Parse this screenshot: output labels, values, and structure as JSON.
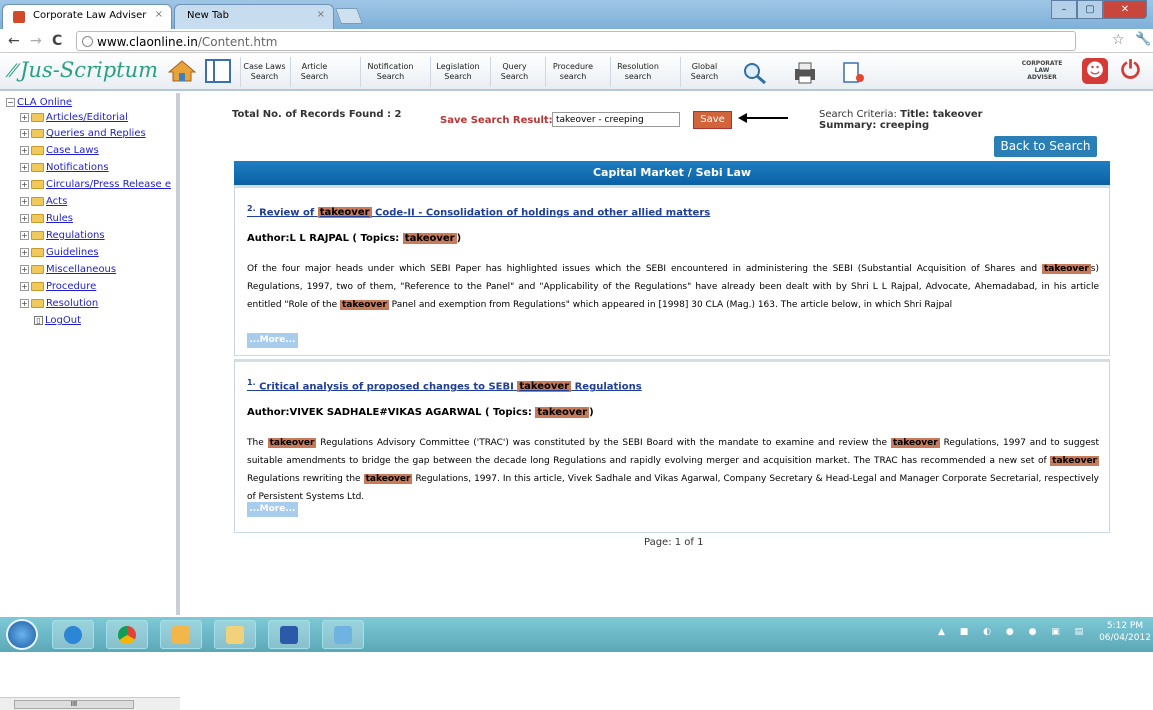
{
  "browser": {
    "tabs": [
      {
        "title": "Corporate Law Adviser",
        "active": true
      },
      {
        "title": "New Tab",
        "active": false
      }
    ],
    "url_domain": "www.claonline.in",
    "url_path": "/Content.htm"
  },
  "app": {
    "logo_text": "Jus-Scriptum",
    "toolbar": [
      {
        "line1": "Case Laws",
        "line2": "Search"
      },
      {
        "line1": "Article",
        "line2": "Search"
      },
      {
        "line1": "Notification",
        "line2": "Search"
      },
      {
        "line1": "Legislation",
        "line2": "Search"
      },
      {
        "line1": "Query",
        "line2": "Search"
      },
      {
        "line1": "Procedure",
        "line2": "search"
      },
      {
        "line1": "Resolution",
        "line2": "search"
      },
      {
        "line1": "Global",
        "line2": "Search"
      }
    ],
    "cla_logo": [
      "CORPORATE",
      "LAW",
      "ADVISER"
    ]
  },
  "sidebar": {
    "root": "CLA Online",
    "items": [
      "Articles/Editorial",
      "Queries and Replies",
      "Case Laws",
      "Notifications",
      "Circulars/Press Release e",
      "Acts",
      "Rules",
      "Regulations",
      "Guidelines",
      "Miscellaneous",
      "Procedure",
      "Resolution"
    ],
    "logout": "LogOut",
    "scroll_thumb": "III"
  },
  "results": {
    "total_label": "Total No. of Records Found : 2",
    "save_label": "Save Search Result:",
    "save_value": "takeover - creeping",
    "save_button": "Save",
    "criteria_label": "Search Criteria:",
    "criteria_title": "Title: takeover",
    "criteria_summary": "Summary: creeping",
    "back_button": "Back to Search",
    "category_header": "Capital Market / Sebi Law",
    "highlight_term": "takeover",
    "items": [
      {
        "number": "2.",
        "title_pre": "Review of",
        "title_post": "Code-II - Consolidation of holdings and other allied matters",
        "author_pre": "Author:L L RAJPAL ( Topics:",
        "author_post": ")",
        "body": [
          "Of the four major heads under which SEBI Paper has highlighted issues which the SEBI encountered in administering the SEBI (Substantial Acquisition of Shares and ",
          "s) Regulations, 1997, two of them, \"Reference to the Panel\" and \"Applicability of the Regulations\" have already been dealt with by Shri L L Rajpal, Advocate, Ahemadabad, in his article entitled \"Role of the ",
          " Panel and exemption from Regulations\" which appeared in [1998] 30 CLA (Mag.) 163. The article below, in which Shri Rajpal"
        ],
        "more": "...More..."
      },
      {
        "number": "1.",
        "title_pre": "Critical analysis of proposed changes to SEBI",
        "title_post": "Regulations",
        "author_pre": "Author:VIVEK SADHALE#VIKAS AGARWAL ( Topics:",
        "author_post": ")",
        "body": [
          "The ",
          " Regulations Advisory Committee ('TRAC') was constituted by the SEBI Board with the mandate to examine and review the ",
          " Regulations, 1997 and to suggest suitable amendments to bridge the gap between the decade long Regulations and rapidly evolving merger and acquisition market. The TRAC has recommended a new set of ",
          " Regulations rewriting the ",
          " Regulations, 1997. In this article, Vivek Sadhale and Vikas Agarwal, Company Secretary & Head-Legal and Manager Corporate Secretarial, respectively of Persistent Systems Ltd."
        ],
        "more": "...More..."
      }
    ],
    "page_info": "Page: 1 of 1"
  },
  "taskbar": {
    "time": "5:12 PM",
    "date": "06/04/2012"
  },
  "colors": {
    "highlight": "#c87a5b",
    "header_blue": "#0a61a4",
    "save_button": "#d2643b",
    "link_blue": "#1f3e96"
  }
}
